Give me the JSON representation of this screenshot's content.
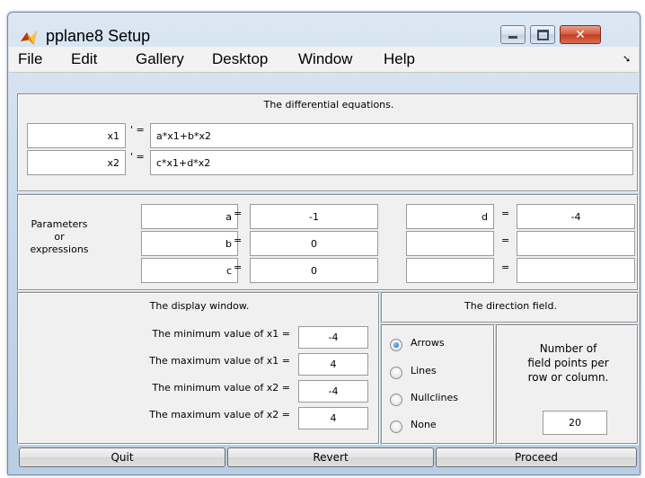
{
  "window": {
    "title": "pplane8 Setup"
  },
  "menu": {
    "items": [
      "File",
      "Edit",
      "Gallery",
      "Desktop",
      "Window",
      "Help"
    ]
  },
  "equations": {
    "heading": "The differential equations.",
    "prime": "' =",
    "rows": [
      {
        "var": "x1",
        "rhs": "a*x1+b*x2"
      },
      {
        "var": "x2",
        "rhs": "c*x1+d*x2"
      }
    ]
  },
  "parameters": {
    "label_lines": [
      "Parameters",
      "or",
      "expressions"
    ],
    "equals": "=",
    "left": [
      {
        "name": "a",
        "value": "-1"
      },
      {
        "name": "b",
        "value": "0"
      },
      {
        "name": "c",
        "value": "0"
      }
    ],
    "right": [
      {
        "name": "d",
        "value": "-4"
      },
      {
        "name": "",
        "value": ""
      },
      {
        "name": "",
        "value": ""
      }
    ]
  },
  "display_window": {
    "heading": "The display window.",
    "rows": [
      {
        "label": "The minimum value of x1 =",
        "value": "-4"
      },
      {
        "label": "The maximum value of x1 =",
        "value": "4"
      },
      {
        "label": "The minimum value of x2 =",
        "value": "-4"
      },
      {
        "label": "The maximum value of x2 =",
        "value": "4"
      }
    ]
  },
  "direction_field": {
    "heading": "The direction field.",
    "options": [
      {
        "label": "Arrows",
        "selected": true
      },
      {
        "label": "Lines",
        "selected": false
      },
      {
        "label": "Nullclines",
        "selected": false
      },
      {
        "label": "None",
        "selected": false
      }
    ],
    "points_label_lines": [
      "Number of",
      "field points per",
      "row or column."
    ],
    "points_value": "20"
  },
  "buttons": {
    "quit": "Quit",
    "revert": "Revert",
    "proceed": "Proceed"
  },
  "colors": {
    "selected_radio": "#1a64c8",
    "app_icon": "#e8901a"
  }
}
